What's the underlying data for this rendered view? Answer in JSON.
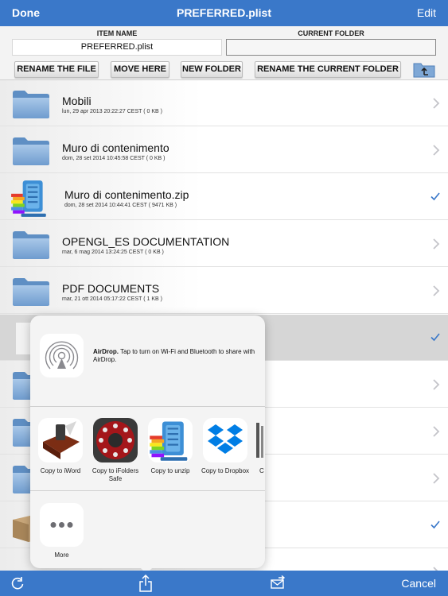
{
  "navbar": {
    "done": "Done",
    "title": "PREFERRED.plist",
    "edit": "Edit"
  },
  "panel": {
    "item_name_label": "ITEM NAME",
    "current_folder_label": "CURRENT FOLDER",
    "item_name_value": "PREFERRED.plist",
    "current_folder_value": "",
    "buttons": {
      "rename_file": "RENAME THE FILE",
      "move_here": "MOVE HERE",
      "new_folder": "NEW FOLDER",
      "rename_folder": "RENAME THE CURRENT FOLDER"
    },
    "up_icon": "folder-up-icon"
  },
  "files": [
    {
      "name": "Mobili",
      "meta": "lun, 29 apr 2013 20:22:27 CEST ( 0 KB )",
      "icon": "folder-icon",
      "accessory": "chevron"
    },
    {
      "name": "Muro di contenimento",
      "meta": "dom, 28 set 2014 10:45:58 CEST ( 0 KB )",
      "icon": "folder-icon",
      "accessory": "chevron"
    },
    {
      "name": "Muro di contenimento.zip",
      "meta": "dom, 28 set 2014 10:44:41 CEST ( 9471 KB )",
      "icon": "zip-icon",
      "accessory": "check"
    },
    {
      "name": "OPENGL_ES DOCUMENTATION",
      "meta": "mar, 6 mag 2014 13:24:25 CEST ( 0 KB )",
      "icon": "folder-icon",
      "accessory": "chevron"
    },
    {
      "name": "PDF DOCUMENTS",
      "meta": "mar, 21 ott 2014 05:17:22 CEST ( 1 KB )",
      "icon": "folder-icon",
      "accessory": "chevron"
    }
  ],
  "share_sheet": {
    "airdrop_title": "AirDrop.",
    "airdrop_text": " Tap to turn on Wi-Fi and Bluetooth to share with AirDrop.",
    "apps": [
      {
        "label": "Copy to iWord",
        "icon": "iword-app-icon"
      },
      {
        "label": "Copy to iFolders Safe",
        "icon": "ifolders-safe-app-icon"
      },
      {
        "label": "Copy to unzip",
        "icon": "unzip-app-icon"
      },
      {
        "label": "Copy to Dropbox",
        "icon": "dropbox-app-icon"
      },
      {
        "label": "C",
        "icon": "partial-app-icon"
      }
    ],
    "more_label": "More"
  },
  "toolbar": {
    "cancel": "Cancel",
    "icons": [
      "refresh-icon",
      "share-icon",
      "send-mail-icon"
    ]
  },
  "colors": {
    "accent": "#3a78c9",
    "selected_row": "#d6d6d6",
    "check": "#3a78c9"
  }
}
